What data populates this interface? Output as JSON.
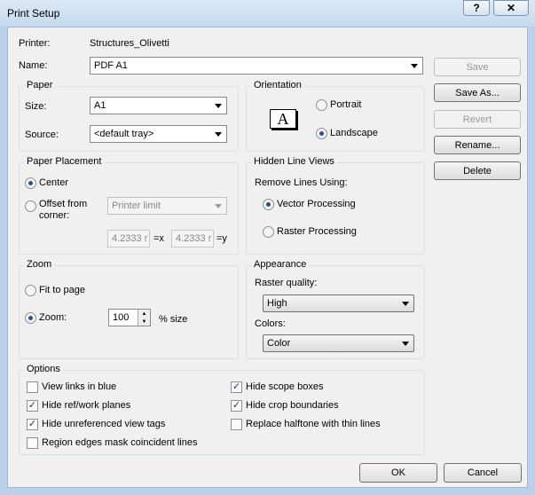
{
  "window": {
    "title": "Print Setup",
    "help_glyph": "?",
    "close_glyph": "✕"
  },
  "printer": {
    "label": "Printer:",
    "value": "Structures_Olivetti"
  },
  "name": {
    "label": "Name:",
    "value": "PDF A1"
  },
  "paper": {
    "title": "Paper",
    "size_label": "Size:",
    "size_value": "A1",
    "source_label": "Source:",
    "source_value": "<default tray>"
  },
  "orientation": {
    "title": "Orientation",
    "icon_letter": "A",
    "portrait": "Portrait",
    "landscape": "Landscape",
    "selected": "landscape"
  },
  "placement": {
    "title": "Paper Placement",
    "center": "Center",
    "offset_line1": "Offset from",
    "offset_line2": "corner:",
    "offset_combo": "Printer limit",
    "x_value": "4.2333 r",
    "x_suffix": "=x",
    "y_value": "4.2333 r",
    "y_suffix": "=y",
    "selected": "center"
  },
  "hidden_lines": {
    "title": "Hidden Line Views",
    "remove_label": "Remove Lines Using:",
    "vector": "Vector Processing",
    "raster": "Raster Processing",
    "selected": "vector"
  },
  "zoom": {
    "title": "Zoom",
    "fit": "Fit to page",
    "zoom_label": "Zoom:",
    "zoom_value": "100",
    "size_suffix": "% size",
    "selected": "zoom"
  },
  "appearance": {
    "title": "Appearance",
    "raster_quality_label": "Raster quality:",
    "raster_quality_value": "High",
    "colors_label": "Colors:",
    "colors_value": "Color"
  },
  "options": {
    "title": "Options",
    "view_links_blue": "View links in blue",
    "hide_ref_planes": "Hide ref/work planes",
    "hide_unref_tags": "Hide unreferenced view tags",
    "region_edges": "Region edges mask coincident lines",
    "hide_scope_boxes": "Hide scope boxes",
    "hide_crop_boundaries": "Hide crop boundaries",
    "replace_halftone": "Replace halftone with thin lines",
    "check_glyph": "✓"
  },
  "buttons": {
    "save": "Save",
    "save_as": "Save As...",
    "revert": "Revert",
    "rename": "Rename...",
    "delete": "Delete",
    "ok": "OK",
    "cancel": "Cancel"
  }
}
